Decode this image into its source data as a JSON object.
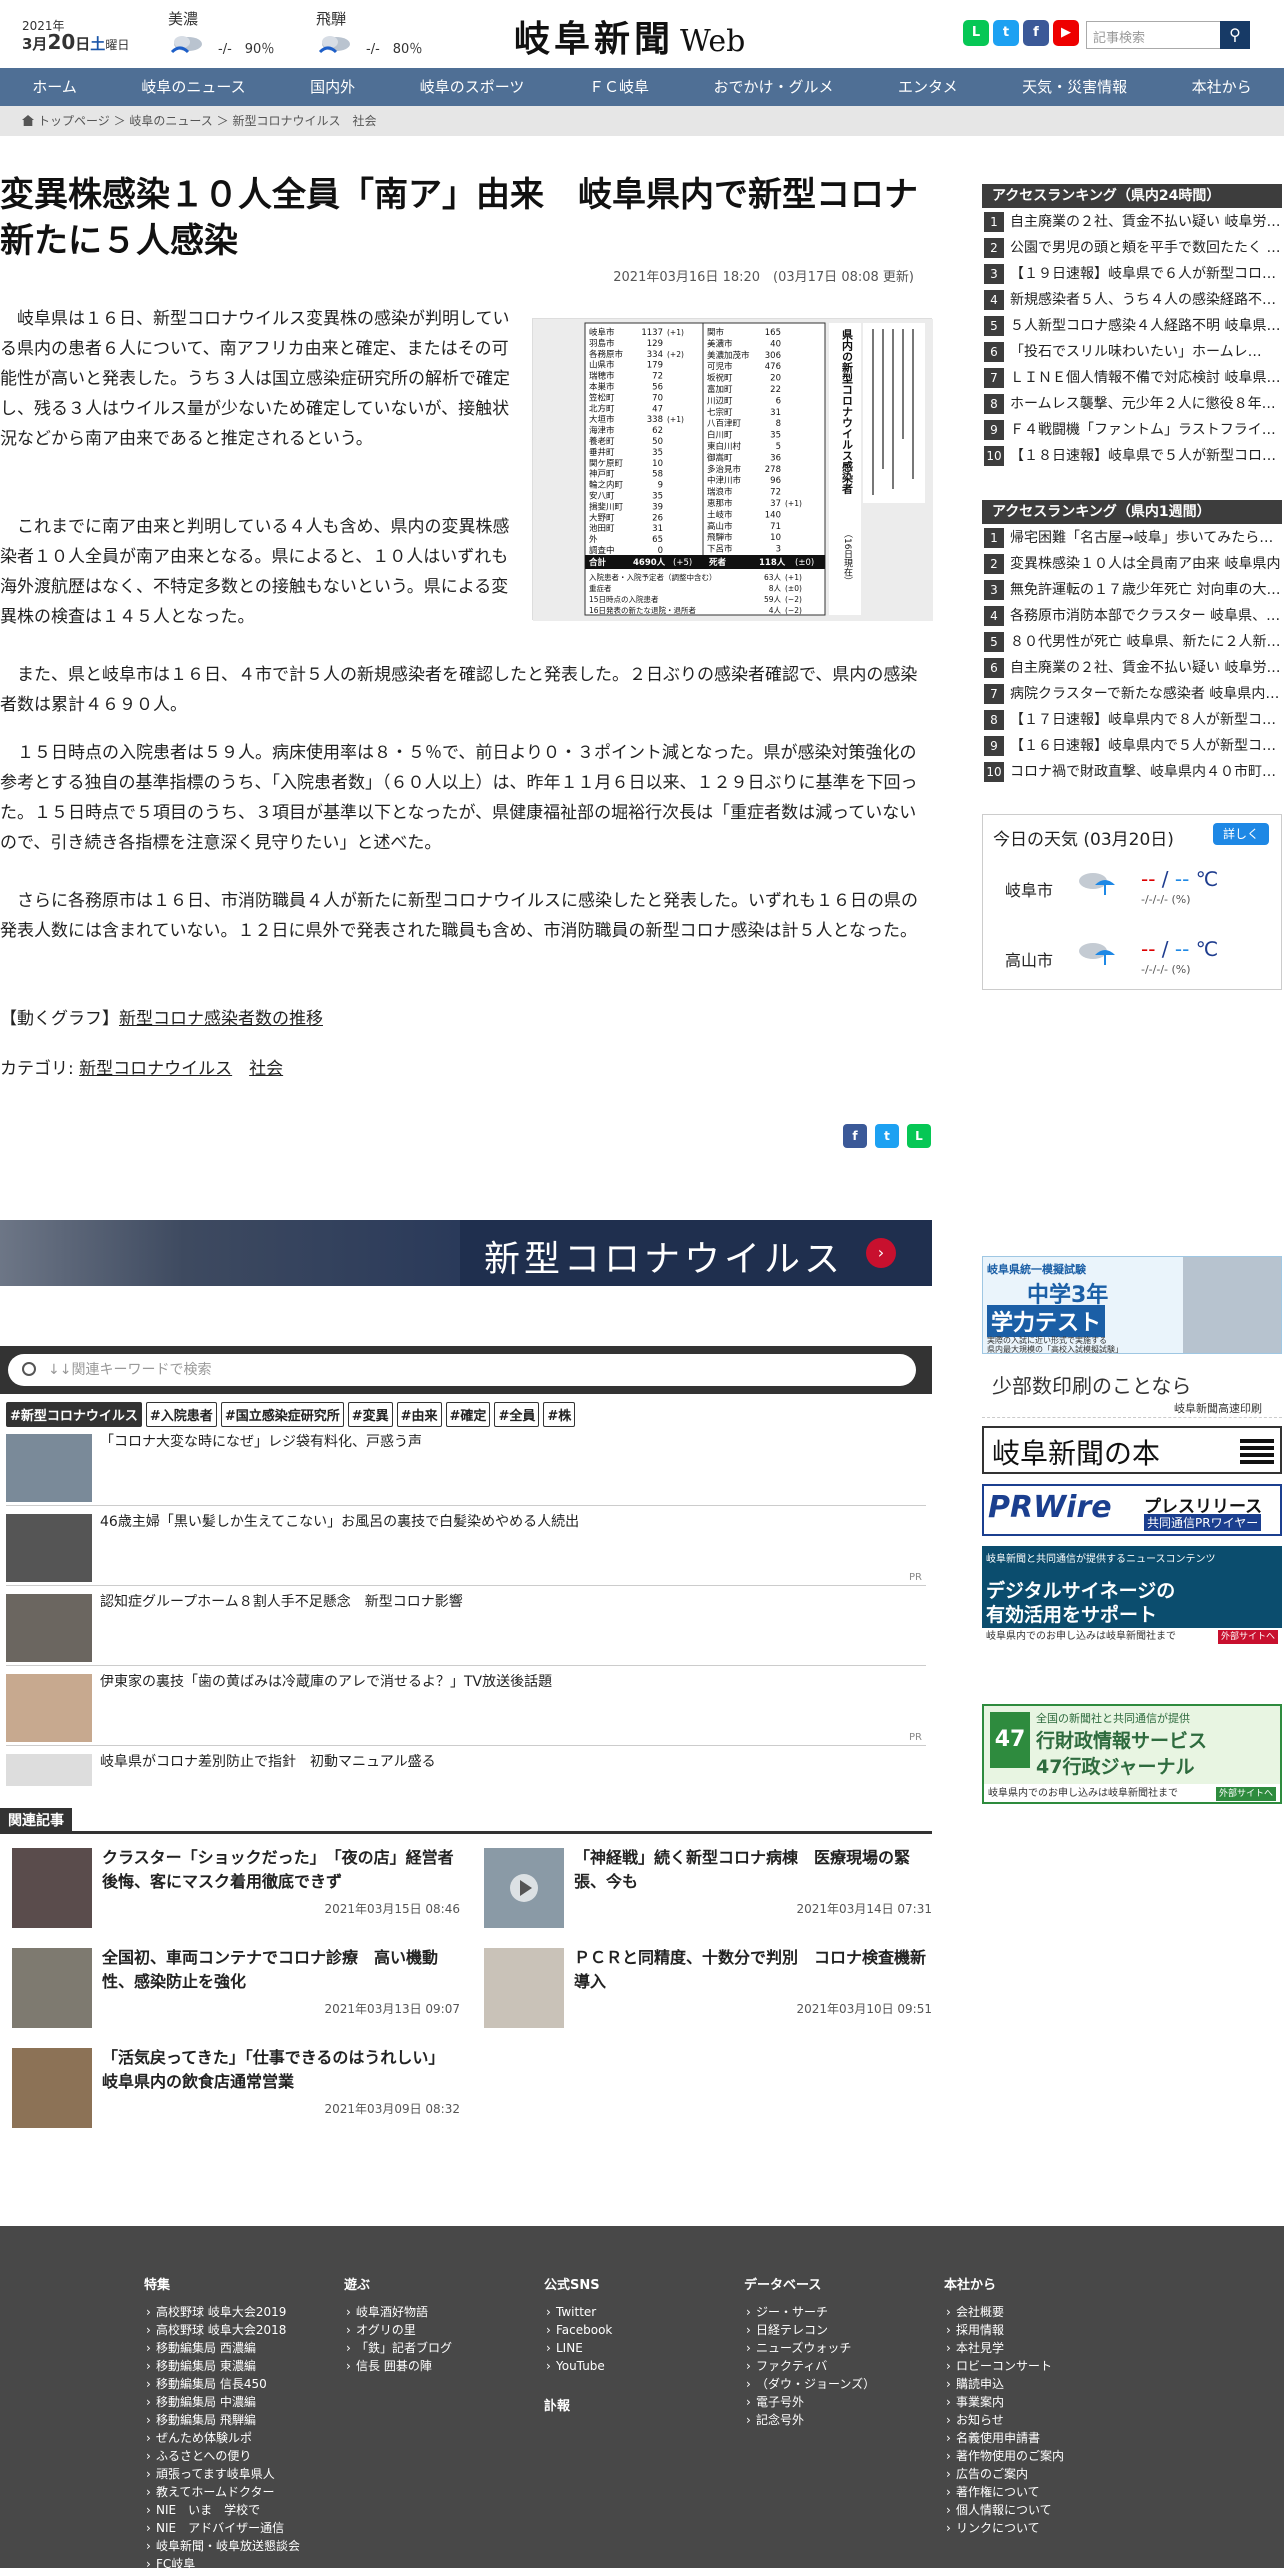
{
  "header": {
    "year": "2021年",
    "month_day_pre": "3月",
    "day": "20",
    "day_suffix": "日",
    "weekday": "土",
    "weekday_suffix": "曜日",
    "weather_mini": [
      {
        "name": "美濃",
        "temp": "-/-",
        "prob": "90％"
      },
      {
        "name": "飛騨",
        "temp": "-/-",
        "prob": "80％"
      }
    ],
    "logo_main": "岐阜新聞",
    "logo_web": "Web",
    "search_placeholder": "記事検索"
  },
  "nav": [
    "ホーム",
    "岐阜のニュース",
    "国内外",
    "岐阜のスポーツ",
    "ＦＣ岐阜",
    "おでかけ・グルメ",
    "エンタメ",
    "天気・災害情報",
    "本社から"
  ],
  "breadcrumb": [
    "トップページ",
    "岐阜のニュース",
    "新型コロナウイルス",
    "社会"
  ],
  "article": {
    "title": "変異株感染１０人全員「南ア」由来　岐阜県内で新型コロナ新たに５人感染",
    "date": "2021年03月16日 18:20　(03月17日 08:08 更新)",
    "paragraphs": [
      "岐阜県は１６日、新型コロナウイルス変異株の感染が判明している県内の患者６人について、南アフリカ由来と確定、またはその可能性が高いと発表した。うち３人は国立感染症研究所の解析で確定し、残る３人はウイルス量が少ないため確定していないが、接触状況などから南ア由来であると推定されるという。",
      "これまでに南ア由来と判明している４人も含め、県内の変異株感染者１０人全員が南ア由来となる。県によると、１０人はいずれも海外渡航歴はなく、不特定多数との接触もないという。県による変異株の検査は１４５人となった。",
      "また、県と岐阜市は１６日、４市で計５人の新規感染者を確認したと発表した。２日ぶりの感染者確認で、県内の感染者数は累計４６９０人。",
      "１５日時点の入院患者は５９人。病床使用率は８・５％で、前日より０・３ポイント減となった。県が感染対策強化の参考とする独自の基準指標のうち、「入院患者数」（６０人以上）は、昨年１１月６日以来、１２９日ぶりに基準を下回った。１５日時点で５項目のうち、３項目が基準以下となったが、県健康福祉部の堀裕行次長は「重症者数は減っていないので、引き続き各指標を注意深く見守りたい」と述べた。",
      "さらに各務原市は１６日、市消防職員４人が新たに新型コロナウイルスに感染したと発表した。いずれも１６日の県の発表人数には含まれていない。１２日に県外で発表された職員も含め、市消防職員の新型コロナ感染は計５人となった。"
    ],
    "graph_prefix": "【動くグラフ】",
    "graph_link": "新型コロナ感染者数の推移",
    "category_label": "カテゴリ:",
    "categories": [
      "新型コロナウイルス",
      "社会"
    ],
    "photo_table": {
      "title": "県内の新型コロナウイルス感染者",
      "date_note": "（16日現在）",
      "left": [
        [
          "岐阜市",
          "1137",
          "(+1)"
        ],
        [
          "羽島市",
          "129",
          ""
        ],
        [
          "各務原市",
          "334",
          "(+2)"
        ],
        [
          "山県市",
          "179",
          ""
        ],
        [
          "瑞穂市",
          "72",
          ""
        ],
        [
          "本巣市",
          "56",
          ""
        ],
        [
          "笠松町",
          "70",
          ""
        ],
        [
          "北方町",
          "47",
          ""
        ],
        [
          "大垣市",
          "338",
          "(+1)"
        ],
        [
          "海津市",
          "62",
          ""
        ],
        [
          "養老町",
          "50",
          ""
        ],
        [
          "垂井町",
          "35",
          ""
        ],
        [
          "関ケ原町",
          "10",
          ""
        ],
        [
          "神戸町",
          "58",
          ""
        ],
        [
          "輪之内町",
          "9",
          ""
        ],
        [
          "安八町",
          "35",
          ""
        ],
        [
          "揖斐川町",
          "39",
          ""
        ],
        [
          "大野町",
          "26",
          ""
        ],
        [
          "池田町",
          "31",
          ""
        ],
        [
          "外",
          "65",
          ""
        ],
        [
          "調査中",
          "0",
          ""
        ]
      ],
      "right": [
        [
          "関市",
          "165",
          ""
        ],
        [
          "美濃市",
          "40",
          ""
        ],
        [
          "美濃加茂市",
          "306",
          ""
        ],
        [
          "可児市",
          "476",
          ""
        ],
        [
          "坂祝町",
          "20",
          ""
        ],
        [
          "富加町",
          "22",
          ""
        ],
        [
          "川辺町",
          "6",
          ""
        ],
        [
          "七宗町",
          "31",
          ""
        ],
        [
          "八百津町",
          "8",
          ""
        ],
        [
          "白川町",
          "35",
          ""
        ],
        [
          "東白川村",
          "5",
          ""
        ],
        [
          "御嵩町",
          "36",
          ""
        ],
        [
          "多治見市",
          "278",
          ""
        ],
        [
          "中津川市",
          "96",
          ""
        ],
        [
          "瑞浪市",
          "72",
          ""
        ],
        [
          "恵那市",
          "37",
          "(+1)"
        ],
        [
          "土岐市",
          "140",
          ""
        ],
        [
          "高山市",
          "71",
          ""
        ],
        [
          "飛騨市",
          "10",
          ""
        ],
        [
          "下呂市",
          "3",
          ""
        ]
      ],
      "summary": [
        [
          "合計",
          "4690人",
          "(+5)",
          "死者",
          "118人",
          "(±0)"
        ],
        [
          "入院患者・入院予定者（調整中含む）",
          "63人",
          "(+1)"
        ],
        [
          "重症者",
          "8人",
          "(±0)"
        ],
        [
          "15日時点の入院患者",
          "59人",
          "(−2)"
        ],
        [
          "16日発表の新たな退院・退所者",
          "4人",
          "(−2)"
        ]
      ]
    }
  },
  "share": [
    "f",
    "t",
    "L"
  ],
  "banner": {
    "title": "新型コロナウイルス"
  },
  "keyword_search": {
    "placeholder": "↓↓関連キーワードで検索"
  },
  "tags": [
    "#新型コロナウイルス",
    "#入院患者",
    "#国立感染症研究所",
    "#変異",
    "#由来",
    "#確定",
    "#全員",
    "#株"
  ],
  "related_list": [
    {
      "title": "「コロナ大変な時になぜ」レジ袋有料化、戸惑う声",
      "pr": ""
    },
    {
      "title": "46歳主婦「黒い髪しか生えてこない」お風呂の裏技で白髪染めやめる人続出",
      "pr": "PR"
    },
    {
      "title": "認知症グループホーム８割人手不足懸念　新型コロナ影響",
      "pr": ""
    },
    {
      "title": "伊東家の裏技「歯の黄ばみは冷蔵庫のアレで消せるよ？」TV放送後話題",
      "pr": "PR"
    },
    {
      "title": "岐阜県がコロナ差別防止で指針　初動マニュアル盛る",
      "pr": ""
    }
  ],
  "related_articles_label": "関連記事",
  "related_articles": [
    {
      "title": "クラスター「ショックだった」　「夜の店」経営者後悔、客にマスク着用徹底できず",
      "date": "2021年03月15日 08:46"
    },
    {
      "title": "「神経戦」続く新型コロナ病棟　医療現場の緊張、今も",
      "date": "2021年03月14日 07:31"
    },
    {
      "title": "全国初、車両コンテナでコロナ診療　高い機動性、感染防止を強化",
      "date": "2021年03月13日 09:07"
    },
    {
      "title": "ＰＣＲと同精度、十数分で判別　コロナ検査機新導入",
      "date": "2021年03月10日 09:51"
    },
    {
      "title": "「活気戻ってきた」「仕事できるのはうれしい」岐阜県内の飲食店通常営業",
      "date": "2021年03月09日 08:32"
    }
  ],
  "ranking24": {
    "title": "アクセスランキング（県内24時間）",
    "items": [
      "自主廃業の２社、賃金不払い疑い 岐阜労…",
      "公園で男児の頭と頬を平手で数回たたく …",
      "【１９日速報】岐阜県で６人が新型コロ…",
      "新規感染者５人、うち４人の感染経路不…",
      "５人新型コロナ感染４人経路不明 岐阜県…",
      "「投石でスリル味わいたい」ホームレ…",
      "ＬＩＮＥ個人情報不備で対応検討 岐阜県…",
      "ホームレス襲撃、元少年２人に懲役８年…",
      "Ｆ４戦闘機「ファントム」ラストフライ…",
      "【１８日速報】岐阜県で５人が新型コロ…"
    ]
  },
  "ranking_week": {
    "title": "アクセスランキング（県内1週間）",
    "items": [
      "帰宅困難「名古屋→岐阜」歩いてみたら…",
      "変異株感染１０人は全員南ア由来 岐阜県内…",
      "無免許運転の１７歳少年死亡 対向車の大…",
      "各務原市消防本部でクラスター 岐阜県、…",
      "８０代男性が死亡 岐阜県、新たに２人新…",
      "自主廃業の２社、賃金不払い疑い 岐阜労…",
      "病院クラスターで新たな感染者 岐阜県内…",
      "【１７日速報】岐阜県内で８人が新型コ…",
      "【１６日速報】岐阜県内で５人が新型コ…",
      "コロナ禍で財政直撃、岐阜県内４０市町…"
    ]
  },
  "weather": {
    "title": "今日の天気 (03月20日)",
    "more": "詳しく",
    "rows": [
      {
        "city": "岐阜市",
        "hi": "--",
        "lo": "--",
        "unit": "℃",
        "prob": "-/-/-/- (%)"
      },
      {
        "city": "高山市",
        "hi": "--",
        "lo": "--",
        "unit": "℃",
        "prob": "-/-/-/- (%)"
      }
    ]
  },
  "ads": {
    "ad1_l1": "岐阜県統一模擬試験",
    "ad1_l2": "中学3年",
    "ad1_l3": "学力テスト",
    "ad1_l4": "実際の入試に近い形式で実施する",
    "ad1_l5": "県内最大規模の「高校入試模擬試験」",
    "ad2_l1": "少部数印刷のことなら",
    "ad2_l2": "岐阜新聞高速印刷",
    "ad3": "岐阜新聞の本",
    "ad4_l1": "PRWire",
    "ad4_l2": "プレスリリース",
    "ad4_l3": "共同通信PRワイヤー",
    "ad5_l1": "岐阜新聞と共同通信が提供するニュースコンテンツ",
    "ad5_l2": "デジタルサイネージの",
    "ad5_l3": "有効活用をサポート",
    "ad5_l4": "岐阜県内でのお申し込みは岐阜新聞社まで",
    "ad5_l5": "外部サイトへ",
    "ad6_l1": "全国の新聞社と共同通信が提供",
    "ad6_l2": "行財政情報サービス",
    "ad6_l3": "47行政ジャーナル",
    "ad6_l4": "岐阜県内でのお申し込みは岐阜新聞社まで",
    "ad6_l5": "外部サイトへ",
    "ad6_badge": "47"
  },
  "footer": {
    "cols": [
      {
        "h": "特集",
        "items": [
          "高校野球 岐阜大会2019",
          "高校野球 岐阜大会2018",
          "移動編集局 西濃編",
          "移動編集局 東濃編",
          "移動編集局 信長450",
          "移動編集局 中濃編",
          "移動編集局 飛騨編",
          "ぜんため体験ルポ",
          "ふるさとへの便り",
          "頑張ってます岐阜県人",
          "教えてホームドクター",
          "NIE　いま　学校で",
          "NIE　アドバイザー通信",
          "岐阜新聞・岐阜放送懇談会",
          "FC岐阜"
        ]
      },
      {
        "h": "遊ぶ",
        "items": [
          "岐阜酒好物語",
          "オグリの里",
          "「鉄」記者ブログ",
          "信長 囲碁の陣"
        ]
      },
      {
        "h": "公式SNS",
        "items": [
          "Twitter",
          "Facebook",
          "LINE",
          "YouTube"
        ],
        "h2": "訃報"
      },
      {
        "h": "データベース",
        "items": [
          "ジー・サーチ",
          "日経テレコン",
          "ニューズウォッチ",
          "ファクティバ",
          "（ダウ・ジョーンズ）",
          "電子号外",
          "記念号外"
        ]
      },
      {
        "h": "本社から",
        "items": [
          "会社概要",
          "採用情報",
          "本社見学",
          "ロビーコンサート",
          "購読申込",
          "事業案内",
          "お知らせ",
          "名義使用申請書",
          "著作物使用のご案内",
          "広告のご案内",
          "著作権について",
          "個人情報について",
          "リンクについて"
        ]
      }
    ]
  },
  "colors": {
    "nav": "#4f6f95",
    "accent_red": "#c8102e",
    "footer": "#484848",
    "rank_badge": "#3d3d3d"
  }
}
